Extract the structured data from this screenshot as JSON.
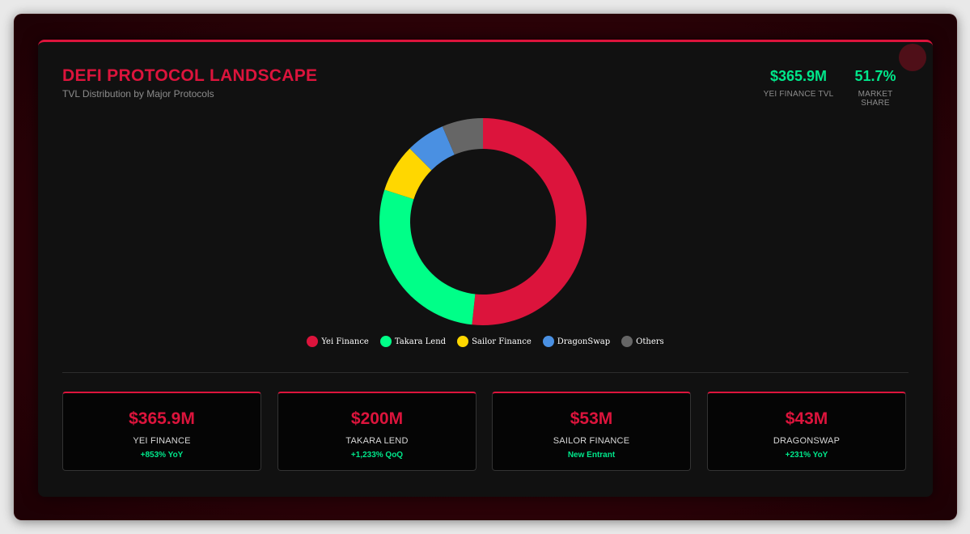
{
  "header": {
    "title": "DEFI PROTOCOL LANDSCAPE",
    "subtitle": "TVL Distribution by Major Protocols"
  },
  "stats": [
    {
      "value": "$365.9M",
      "label": "YEI FINANCE TVL"
    },
    {
      "value": "51.7%",
      "label": "MARKET SHARE"
    }
  ],
  "chart_data": {
    "type": "pie",
    "variant": "doughnut",
    "legend_position": "bottom",
    "series": [
      {
        "name": "Yei Finance",
        "value": 51.7,
        "color": "#dc143c"
      },
      {
        "name": "Takara Lend",
        "value": 28.3,
        "color": "#00ff88"
      },
      {
        "name": "Sailor Finance",
        "value": 7.5,
        "color": "#ffd700"
      },
      {
        "name": "DragonSwap",
        "value": 6.1,
        "color": "#4a90e2"
      },
      {
        "name": "Others",
        "value": 6.4,
        "color": "#666666"
      }
    ]
  },
  "kpis": [
    {
      "amount": "$365.9M",
      "name": "YEI FINANCE",
      "change": "+853% YoY"
    },
    {
      "amount": "$200M",
      "name": "TAKARA LEND",
      "change": "+1,233% QoQ"
    },
    {
      "amount": "$53M",
      "name": "SAILOR FINANCE",
      "change": "New Entrant"
    },
    {
      "amount": "$43M",
      "name": "DRAGONSWAP",
      "change": "+231% YoY"
    }
  ],
  "colors": {
    "accent": "#dc143c",
    "positive": "#00e68a",
    "background": "#111111"
  }
}
